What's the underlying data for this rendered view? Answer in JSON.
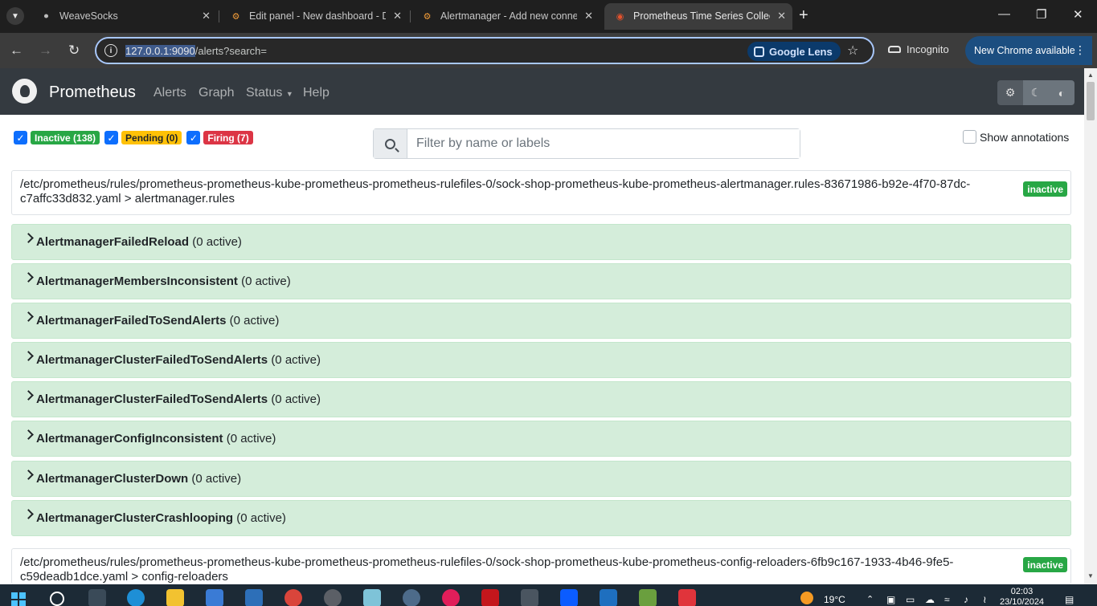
{
  "browser": {
    "tabs": [
      {
        "title": "WeaveSocks",
        "icon": "weavesocks-icon",
        "active": false
      },
      {
        "title": "Edit panel - New dashboard - D",
        "icon": "grafana-icon",
        "active": false
      },
      {
        "title": "Alertmanager - Add new conne",
        "icon": "grafana-icon",
        "active": false
      },
      {
        "title": "Prometheus Time Series Collect",
        "icon": "prometheus-icon",
        "active": true
      }
    ],
    "url_host": "127.0.0.1:9090",
    "url_path": "/alerts?search=",
    "lens_label": "Google Lens",
    "incognito_label": "Incognito",
    "update_label": "New Chrome available"
  },
  "navbar": {
    "brand": "Prometheus",
    "links": [
      "Alerts",
      "Graph",
      "Status",
      "Help"
    ]
  },
  "filters": {
    "inactive_label": "Inactive (138)",
    "pending_label": "Pending (0)",
    "firing_label": "Firing (7)",
    "search_placeholder": "Filter by name or labels",
    "show_annotations_label": "Show annotations"
  },
  "groups": [
    {
      "path": "/etc/prometheus/rules/prometheus-prometheus-kube-prometheus-prometheus-rulefiles-0/sock-shop-prometheus-kube-prometheus-alertmanager.rules-83671986-b92e-4f70-87dc-c7affc33d832.yaml > alertmanager.rules",
      "state": "inactive",
      "rules": [
        {
          "name": "AlertmanagerFailedReload",
          "count": "(0 active)"
        },
        {
          "name": "AlertmanagerMembersInconsistent",
          "count": "(0 active)"
        },
        {
          "name": "AlertmanagerFailedToSendAlerts",
          "count": "(0 active)"
        },
        {
          "name": "AlertmanagerClusterFailedToSendAlerts",
          "count": "(0 active)"
        },
        {
          "name": "AlertmanagerClusterFailedToSendAlerts",
          "count": "(0 active)"
        },
        {
          "name": "AlertmanagerConfigInconsistent",
          "count": "(0 active)"
        },
        {
          "name": "AlertmanagerClusterDown",
          "count": "(0 active)"
        },
        {
          "name": "AlertmanagerClusterCrashlooping",
          "count": "(0 active)"
        }
      ]
    },
    {
      "path": "/etc/prometheus/rules/prometheus-prometheus-kube-prometheus-prometheus-rulefiles-0/sock-shop-prometheus-kube-prometheus-config-reloaders-6fb9c167-1933-4b46-9fe5-c59deadb1dce.yaml > config-reloaders",
      "state": "inactive"
    }
  ],
  "taskbar": {
    "temperature": "19°C",
    "time": "02:03",
    "date": "23/10/2024"
  }
}
